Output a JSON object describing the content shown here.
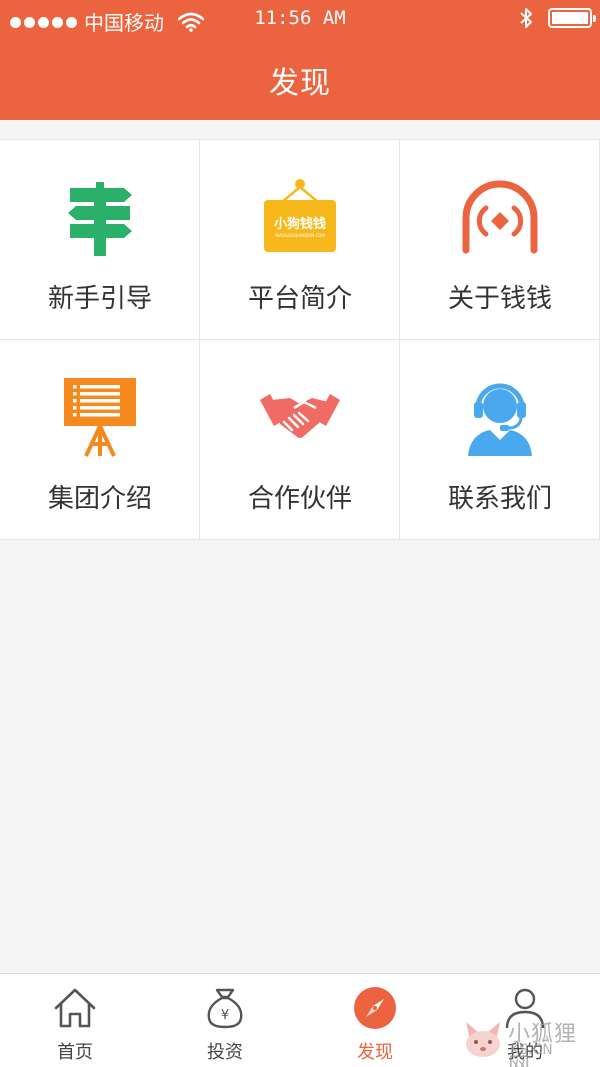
{
  "status_bar": {
    "carrier": "中国移动",
    "time": "11:56 AM",
    "battery_level": 1.0,
    "icons": [
      "signal-dots-icon",
      "wifi-icon",
      "bluetooth-icon",
      "battery-icon"
    ]
  },
  "header": {
    "title": "发现",
    "background": "#ec633f"
  },
  "grid": {
    "items": [
      {
        "label": "新手引导",
        "icon": "signpost-icon",
        "color": "#2bb06a"
      },
      {
        "label": "平台简介",
        "icon": "signboard-icon",
        "color": "#f6b81a",
        "sign_text": "小狗钱钱",
        "sign_subtext": "XIAOGOUQIANQIAN.COM"
      },
      {
        "label": "关于钱钱",
        "icon": "arch-coin-icon",
        "color": "#ec633f"
      },
      {
        "label": "集团介绍",
        "icon": "presentation-board-icon",
        "color": "#f5891d"
      },
      {
        "label": "合作伙伴",
        "icon": "handshake-icon",
        "color": "#ef6b64"
      },
      {
        "label": "联系我们",
        "icon": "customer-service-icon",
        "color": "#4aa8ee"
      }
    ]
  },
  "tabbar": {
    "active_color": "#ec633f",
    "tabs": [
      {
        "label": "首页",
        "icon": "home-icon",
        "active": false
      },
      {
        "label": "投资",
        "icon": "money-bag-icon",
        "active": false,
        "glyph": "¥"
      },
      {
        "label": "发现",
        "icon": "compass-icon",
        "active": true
      },
      {
        "label": "我的",
        "icon": "user-icon",
        "active": false
      }
    ]
  },
  "watermark": {
    "text": "小狐狸网",
    "subtext": "KS.CN"
  }
}
